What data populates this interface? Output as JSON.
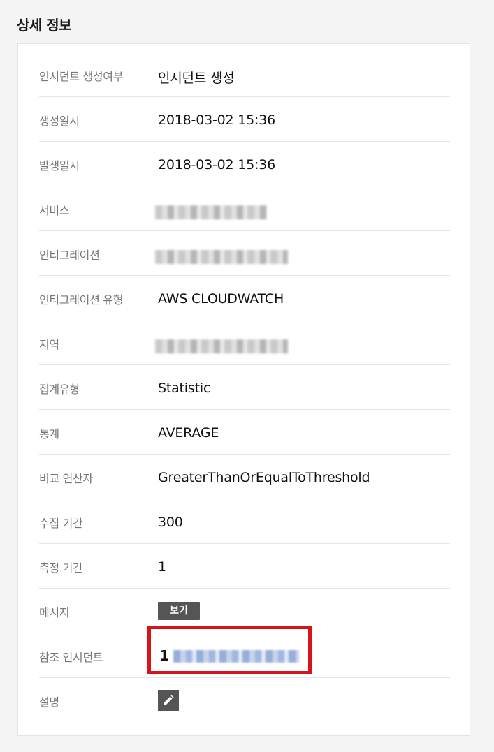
{
  "section": {
    "title": "상세 정보"
  },
  "details": [
    {
      "label": "인시던트 생성여부",
      "value": "인시던트 생성"
    },
    {
      "label": "생성일시",
      "value": "2018-03-02 15:36"
    },
    {
      "label": "발생일시",
      "value": "2018-03-02 15:36"
    },
    {
      "label": "서비스",
      "value": ""
    },
    {
      "label": "인티그레이션",
      "value": ""
    },
    {
      "label": "인티그레이션 유형",
      "value": "AWS CLOUDWATCH"
    },
    {
      "label": "지역",
      "value": ""
    },
    {
      "label": "집계유형",
      "value": "Statistic"
    },
    {
      "label": "통계",
      "value": "AVERAGE"
    },
    {
      "label": "비교 연산자",
      "value": "GreaterThanOrEqualToThreshold"
    },
    {
      "label": "수집 기간",
      "value": "300"
    },
    {
      "label": "측정 기간",
      "value": "1"
    },
    {
      "label": "메시지",
      "button_label": "보기"
    },
    {
      "label": "참조 인시던트",
      "value": "1"
    },
    {
      "label": "설명",
      "icon": "pencil-icon"
    }
  ],
  "colors": {
    "highlight": "#d7141a",
    "button_bg": "#555555"
  }
}
